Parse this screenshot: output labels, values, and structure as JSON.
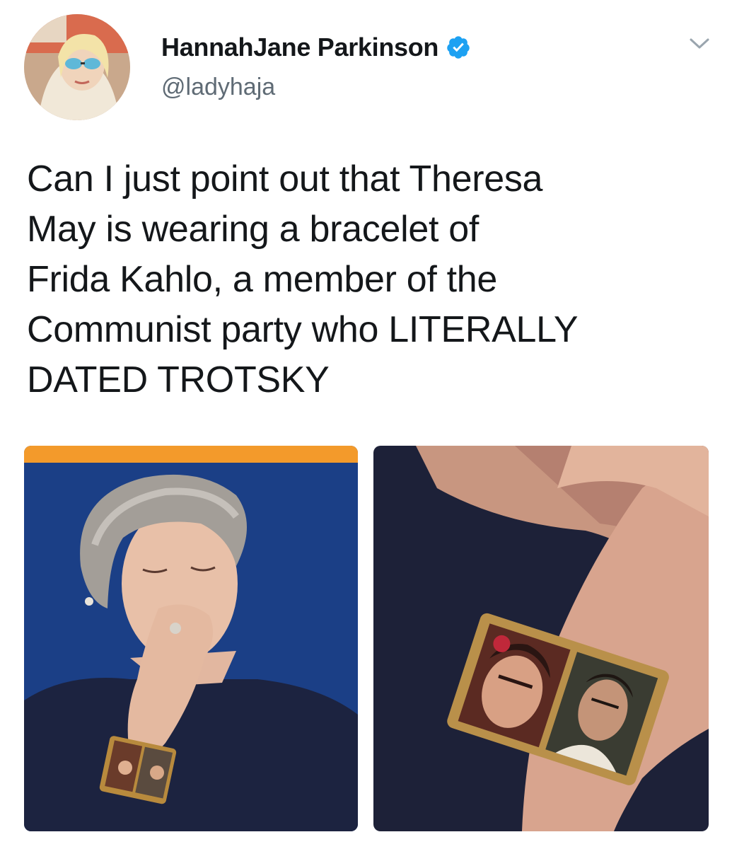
{
  "tweet": {
    "author": {
      "display_name": "HannahJane Parkinson",
      "handle": "@ladyhaja",
      "verified": true
    },
    "text_lines": [
      "Can I just point out that Theresa",
      "May is wearing a bracelet of",
      "Frida Kahlo, a member of the",
      "Communist party who LITERALLY",
      "DATED TROTSKY"
    ],
    "media": [
      {
        "icon": "photo-woman-coughing-bracelet"
      },
      {
        "icon": "photo-bracelet-closeup"
      }
    ]
  },
  "colors": {
    "verified": "#1da1f2",
    "handle": "#5f6b75",
    "text": "#14171a",
    "chevron": "#9aa5ae",
    "stage_blue": "#1b3f86",
    "stage_orange": "#f39a2b"
  }
}
